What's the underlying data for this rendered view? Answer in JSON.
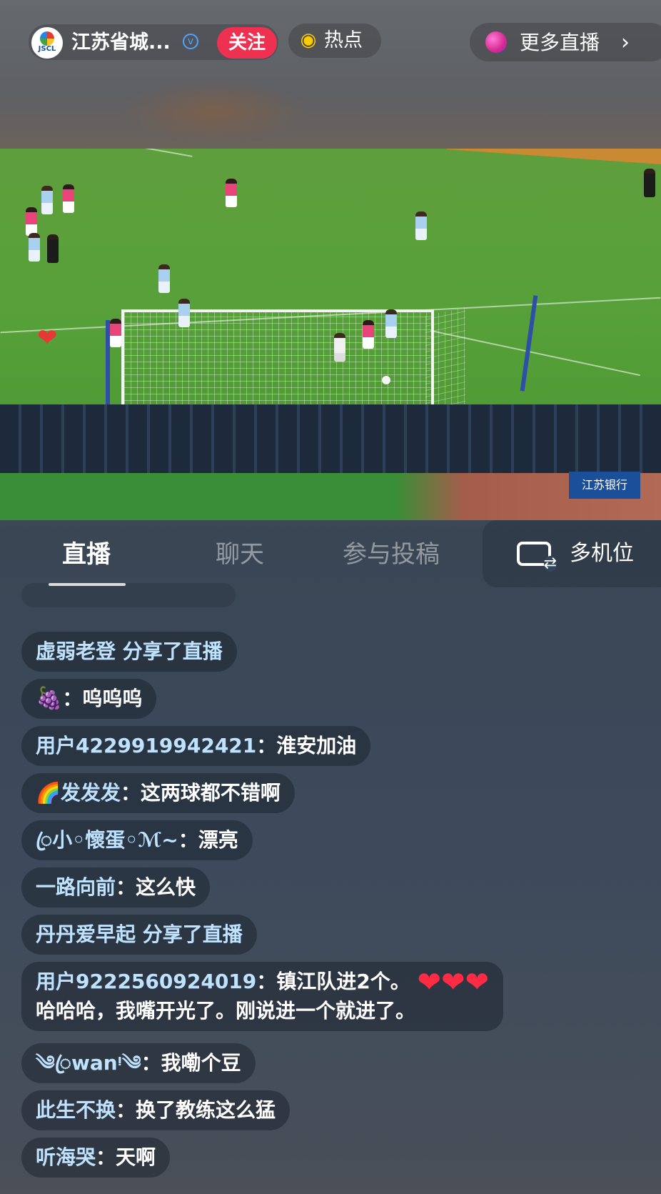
{
  "header": {
    "channel_name": "江苏省城...",
    "logo_text": "JSCL",
    "follow_label": "关注",
    "hot_label": "热点",
    "more_live_label": "更多直播",
    "more_chevron": "›"
  },
  "video": {
    "sponsor_text": "江苏银行"
  },
  "tabs": {
    "items": [
      "直播",
      "聊天",
      "参与投稿"
    ],
    "active": "直播",
    "multicam_label": "多机位"
  },
  "comments": [
    {
      "user": "虚弱老登",
      "text": " 分享了直播",
      "type": "share"
    },
    {
      "user": "🍇",
      "text": "：呜呜呜",
      "type": "chat"
    },
    {
      "user": "用户4229919942421",
      "text": "：淮安加油",
      "type": "chat"
    },
    {
      "user": "🌈发发发",
      "text": "：这两球都不错啊",
      "type": "chat"
    },
    {
      "user": "ꦿ小◦懷蛋◦ℳ~",
      "text": "：漂亮",
      "type": "chat"
    },
    {
      "user": "一路向前",
      "text": "：这么快",
      "type": "chat"
    },
    {
      "user": "丹丹爱早起",
      "text": " 分享了直播",
      "type": "share"
    },
    {
      "user": "用户9222560924019",
      "text": "：镇江队进2个。",
      "line2": "哈哈哈，我嘴开光了。刚说进一个就进了。",
      "type": "chat",
      "hearts": "❤❤❤"
    },
    {
      "user": "༄ꦿwanᵎ༄",
      "text": "：我嘞个豆",
      "type": "chat"
    },
    {
      "user": "此生不换",
      "text": "：换了教练这么猛",
      "type": "chat"
    },
    {
      "user": "听海哭",
      "text": "：天啊",
      "type": "chat"
    }
  ],
  "colors": {
    "follow_button": "#ee3150",
    "username": "#bfe3ff",
    "heart": "#ff2a44",
    "hot_icon": "#ffcc00"
  }
}
